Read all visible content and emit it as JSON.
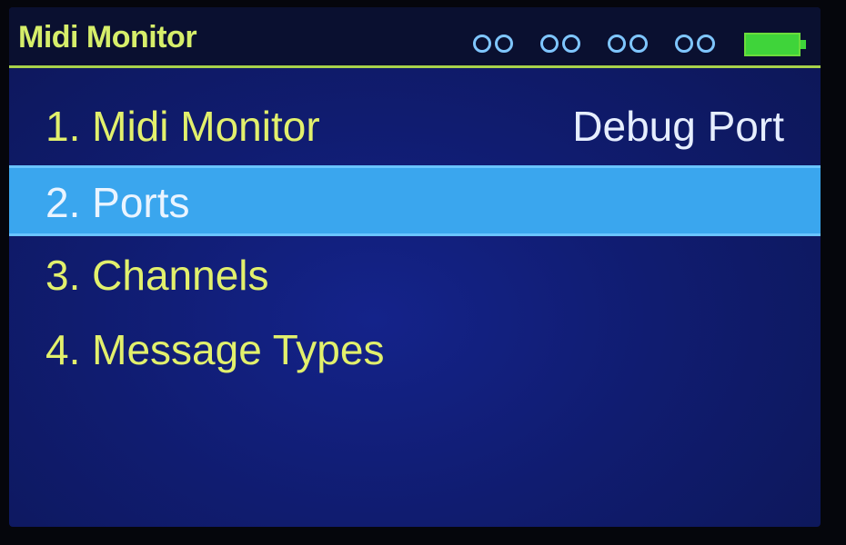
{
  "header": {
    "title": "Midi Monitor",
    "port_indicators": [
      {
        "icon": "port-status-icon"
      },
      {
        "icon": "port-status-icon"
      },
      {
        "icon": "port-status-icon"
      },
      {
        "icon": "port-status-icon"
      }
    ],
    "battery_icon": "battery-full-icon",
    "battery_level": 1.0
  },
  "menu": {
    "items": [
      {
        "label": "1. Midi Monitor",
        "selected": false
      },
      {
        "label": "2. Ports",
        "selected": true
      },
      {
        "label": "3. Channels",
        "selected": false
      },
      {
        "label": "4. Message Types",
        "selected": false
      }
    ],
    "right_label": "Debug Port"
  },
  "colors": {
    "menu_text": "#e2f06c",
    "selection": "#3aa6ee",
    "indicator": "#7fc6ff",
    "battery": "#3fd43a"
  }
}
